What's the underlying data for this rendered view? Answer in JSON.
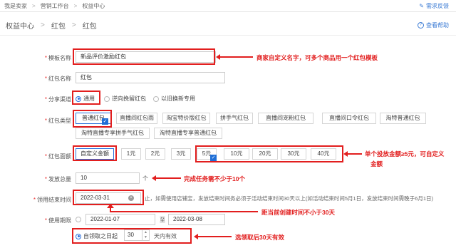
{
  "breadcrumb_top": {
    "seller": "我是卖家",
    "workbench": "营销工作台",
    "center": "权益中心"
  },
  "feedback_label": "需求反馈",
  "breadcrumb_sub": {
    "center": "权益中心",
    "redpacket1": "红包",
    "redpacket2": "红包"
  },
  "help_label": "查看帮助",
  "form": {
    "template_label": "模板名称",
    "template_value": "新品评价激励红包",
    "name_label": "红包名称",
    "name_value": "红包",
    "channel_label": "分享渠道",
    "channel_options": [
      "通用",
      "逆向挽留红包",
      "以旧换新专用"
    ],
    "type_label": "红包类型",
    "type_options": [
      "普通红包",
      "直播间红包雨",
      "淘宝特价版红包",
      "拼手气红包",
      "直播间宠粉红包",
      "直播间口令红包",
      "淘特普通红包",
      "淘特直播专享拼手气红包",
      "淘特直播专享普通红包"
    ],
    "amount_label": "红包面额",
    "amount_options": [
      "自定义金额",
      "1元",
      "2元",
      "3元",
      "5元",
      "10元",
      "20元",
      "30元",
      "40元"
    ],
    "total_label": "发放总量",
    "total_value": "10",
    "total_unit": "个",
    "deadline_label": "领用结束时间",
    "deadline_value": "2022-03-31",
    "deadline_note": "止，如需使用店铺宝，发放结束时间务必须于活动结束时间30天以上(如活动结束时间5月1日，发放结束时间需晚于6月1日)",
    "period_label": "使用期限",
    "period_start": "2022-01-07",
    "period_to": "至",
    "period_end": "2022-03-08",
    "relative_label": "自领取之日起",
    "relative_days": "30",
    "relative_suffix": "天内有效"
  },
  "annotations": {
    "a1": "商家自定义名字，可多个商品用一个红包模板",
    "a2_line1": "单个投放金额≥5元，可自定义",
    "a2_line2": "金额",
    "a3": "完成任务需不少于10个",
    "a4": "距当前创建时间不小于30天",
    "a5": "选领取后30天有效"
  },
  "colors": {
    "annotation": "#e21e1e",
    "accent": "#2a6fdb"
  }
}
